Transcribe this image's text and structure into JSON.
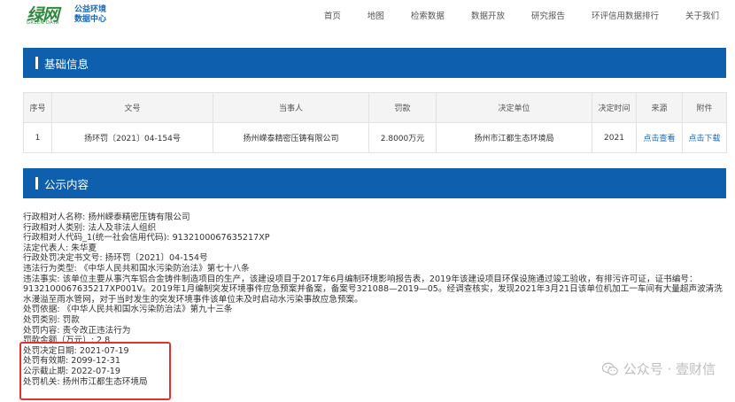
{
  "header": {
    "logo_main": "绿网",
    "logo_sub": "GREEN DATA",
    "logo_line1": "公益环境",
    "logo_line2": "数据中心",
    "nav": [
      "首页",
      "地图",
      "检索数据",
      "数据开放",
      "研究报告",
      "环评信用数据排行",
      "关于我们"
    ]
  },
  "basic_section": {
    "title": "基础信息"
  },
  "table": {
    "headers": [
      "序号",
      "文号",
      "当事人",
      "罚款",
      "决定单位",
      "决定时间",
      "来源",
      "附件"
    ],
    "row": [
      "1",
      "扬环罚〔2021〕04-154号",
      "扬州嵘泰精密压铸有限公司",
      "2.8000万元",
      "扬州市江都生态环境局",
      "2021",
      "点击查看",
      "点击下载"
    ]
  },
  "public_section": {
    "title": "公示内容"
  },
  "details": [
    "行政相对人名称: 扬州嵘泰精密压铸有限公司",
    "行政相对人类别: 法人及非法人组织",
    "行政相对人代码_1(统一社会信用代码): 91321000676352​17XP",
    "法定代表人: 朱华夏",
    "行政处罚决定书文号: 扬环罚〔2021〕04-154号",
    "违法行为类型: 《中华人民共和国水污染防治法》第七十八条",
    "违法事实: 该单位主要从事汽车铝合金铸件制造项目的生产，该建设项目于2017年6月编制环境影响报告表，2019年该建设项目环保设施通过竣工验收，有排污许可证，证书编号：91321000676352​17XP001V。2019年1月编制突发环境事件应急预案并备案，备案号321088—2019—05。经调查核实，发现2021年3月21日该单位机加工一车间有大量超声波清洗水漫溢至雨水管网，对于当时发生的突发环境事件该单位未及时启动水污染事故应急预案。",
    "处罚依据: 《中华人民共和国水污染防治法》第九十三条",
    "处罚类别: 罚款",
    "处罚内容: 责令改正违法行为",
    "罚款金额（万元）: 2.8",
    "处罚决定日期: 2021-07-19",
    "处罚有效期: 2099-12-31",
    "公示截止期: 2022-07-19",
    "处罚机关: 扬州市江都生态环境局"
  ],
  "watermark": {
    "text": "公众号 · 壹财信",
    "icon": "wechat-icon"
  }
}
